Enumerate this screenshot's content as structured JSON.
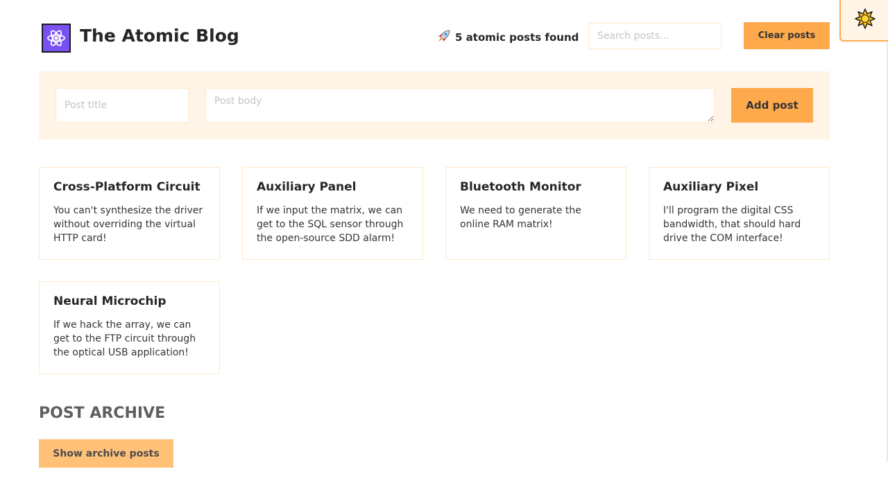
{
  "header": {
    "title": "The Atomic Blog",
    "results_text": "5 atomic posts found",
    "search_placeholder": "Search posts...",
    "clear_label": "Clear posts",
    "logo_icon": "atom-icon",
    "results_icon": "rocket-icon"
  },
  "theme_toggle": {
    "icon": "sun-icon"
  },
  "form": {
    "title_placeholder": "Post title",
    "body_placeholder": "Post body",
    "add_label": "Add post"
  },
  "posts": [
    {
      "title": "Cross-Platform Circuit",
      "body": "You can't synthesize the driver without overriding the virtual HTTP card!"
    },
    {
      "title": "Auxiliary Panel",
      "body": "If we input the matrix, we can get to the SQL sensor through the open-source SDD alarm!"
    },
    {
      "title": "Bluetooth Monitor",
      "body": "We need to generate the online RAM matrix!"
    },
    {
      "title": "Auxiliary Pixel",
      "body": "I'll program the digital CSS bandwidth, that should hard drive the COM interface!"
    },
    {
      "title": "Neural Microchip",
      "body": "If we hack the array, we can get to the FTP circuit through the optical USB application!"
    }
  ],
  "archive": {
    "title": "POST ARCHIVE",
    "button_label": "Show archive posts"
  },
  "colors": {
    "accent": "#ffa94d",
    "panel": "#fff4e6",
    "border": "#ffe8cc",
    "logo": "#7950f2"
  }
}
